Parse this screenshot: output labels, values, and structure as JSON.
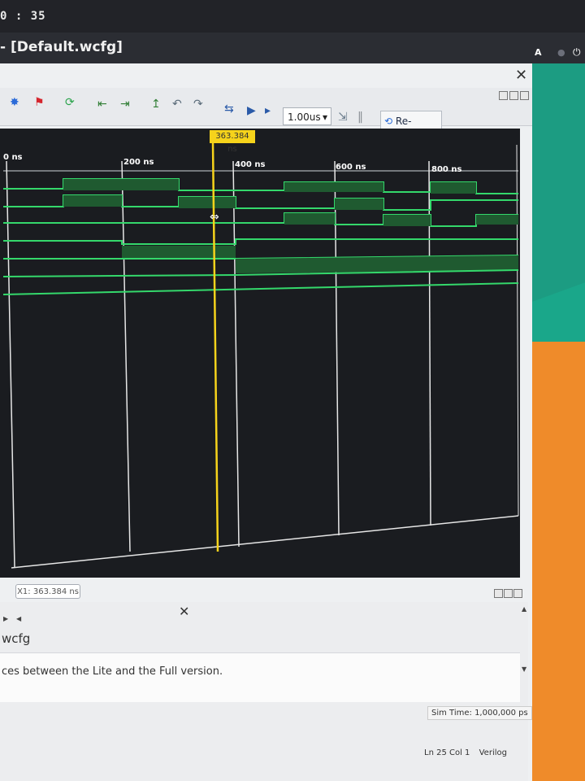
{
  "topbar": {
    "clock": "0 : 35"
  },
  "window": {
    "title": "- [Default.wcfg]",
    "close_glyph": "✕"
  },
  "system_tray": {
    "keyboard": "A",
    "power_glyph": "⏻"
  },
  "toolbar": {
    "zoom_value": "1.00us",
    "zoom_caret": "▾",
    "relaunch_label": "Re-launch",
    "icons": [
      "settings-icon",
      "pin-icon",
      "refresh-icon",
      "step-back-icon",
      "step-over-icon",
      "marker-icon",
      "undo-icon",
      "redo-icon",
      "swap-icon",
      "run-icon",
      "run-for-icon",
      "step-icon",
      "pause-icon"
    ]
  },
  "waveform": {
    "cursor_time": "363.384 ns",
    "cursor_label_full": "X1: 363.384 ns",
    "time_ticks": [
      "0 ns",
      "200 ns",
      "400 ns",
      "600 ns",
      "800 ns"
    ]
  },
  "lower": {
    "tab_close": "✕",
    "config_file": "wcfg",
    "console_message": "ces between the Lite and the Full version.",
    "sim_time": "Sim Time: 1,000,000 ps",
    "cursor_pos": "Ln 25 Col 1",
    "language": "Verilog"
  },
  "colors": {
    "wave_bg": "#1a1c20",
    "signal_green": "#34d86b",
    "bus_fill": "#1f5a30",
    "cursor_yellow": "#f6d31b"
  }
}
